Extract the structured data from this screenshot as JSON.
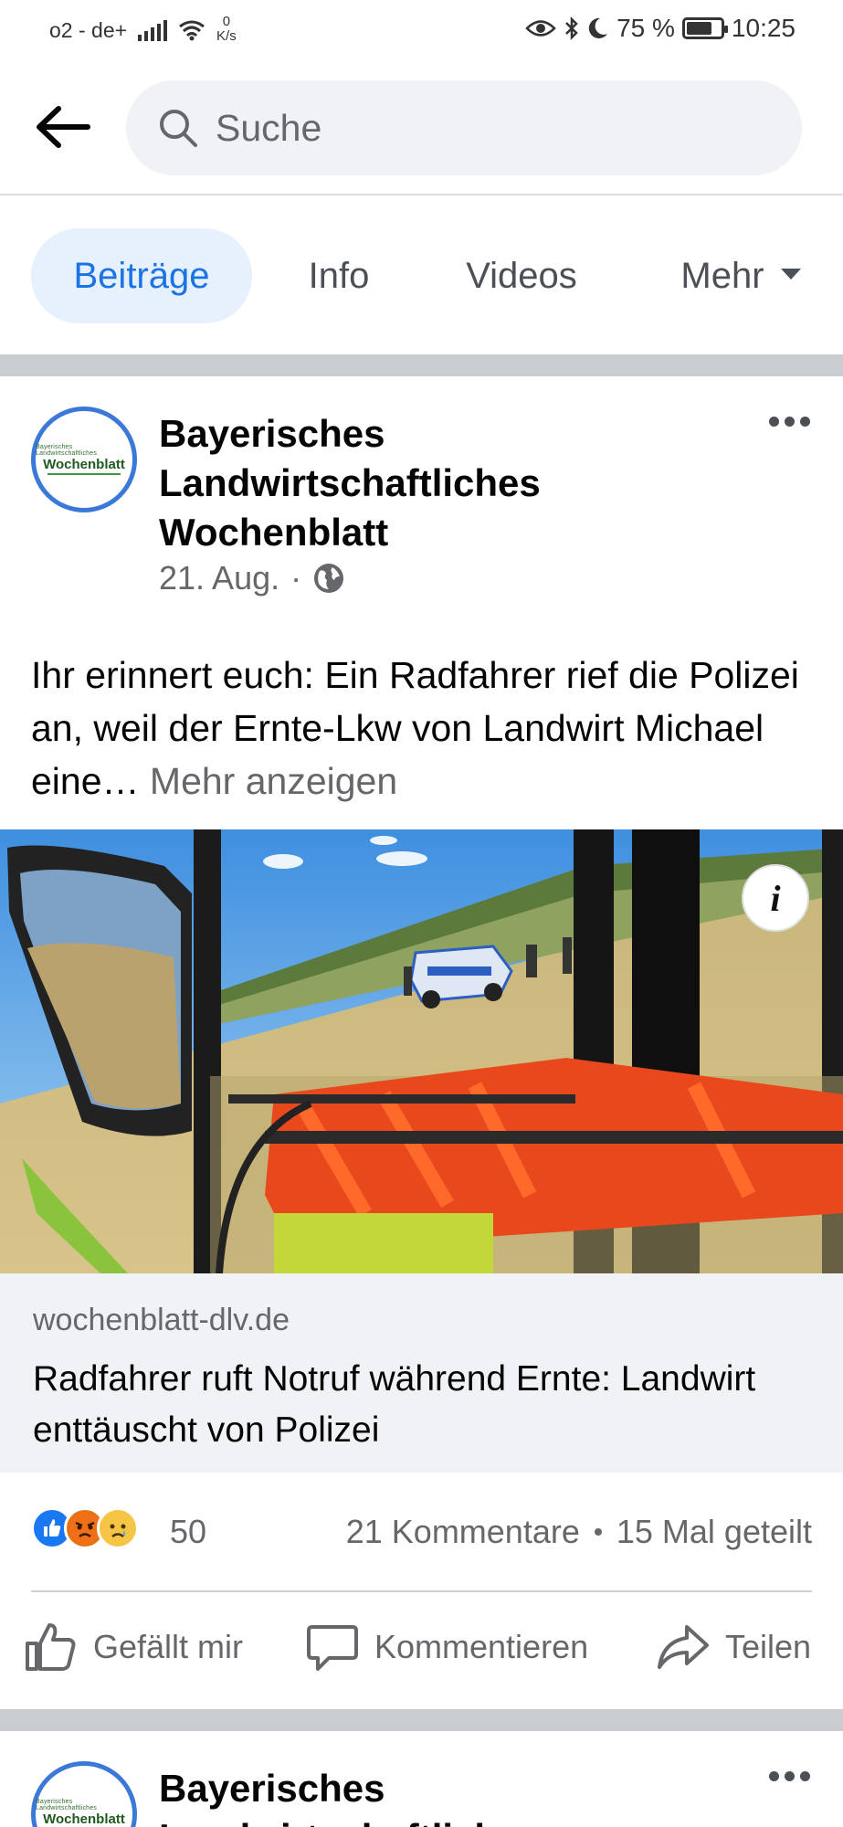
{
  "status_bar": {
    "carrier": "o2 - de+",
    "speed_value": "0",
    "speed_unit": "K/s",
    "battery": "75 %",
    "battery_level": 0.75,
    "time": "10:25"
  },
  "search": {
    "placeholder": "Suche"
  },
  "tabs": [
    {
      "label": "Beiträge",
      "active": true
    },
    {
      "label": "Info",
      "active": false
    },
    {
      "label": "Videos",
      "active": false
    },
    {
      "label": "Mehr",
      "active": false
    }
  ],
  "post": {
    "avatar_small_text": "Bayerisches Landwirtschaftliches",
    "avatar_brand": "Wochenblatt",
    "page_name": "Bayerisches Landwirtschaftliches Wochenblatt",
    "date": "21. Aug.",
    "separator": "·",
    "text": "Ihr erinnert euch: Ein Radfahrer rief die Polizei an, weil der Ernte-Lkw von Landwirt Michael eine…",
    "see_more": "Mehr anzeigen",
    "image_info": "i",
    "link_domain": "wochenblatt-dlv.de",
    "link_title": "Radfahrer ruft Notruf während Ernte: Landwirt enttäuscht von Polizei",
    "reaction_count": "50",
    "comments": "21 Kommentare",
    "shares": "15 Mal geteilt",
    "actions": {
      "like": "Gefällt mir",
      "comment": "Kommentieren",
      "share": "Teilen"
    }
  },
  "post2": {
    "avatar_small_text": "Bayerisches Landwirtschaftliches",
    "avatar_brand": "Wochenblatt",
    "page_name": "Bayerisches Landwirtschaftliches"
  },
  "colors": {
    "accent": "#1b74e4",
    "tab_active_bg": "#e7f0fd",
    "muted_text": "#65676b",
    "divider": "#c9ccd1"
  },
  "icons": [
    "back-arrow-icon",
    "search-icon",
    "globe-icon",
    "more-dots-icon",
    "info-icon",
    "like-reaction-icon",
    "angry-reaction-icon",
    "sad-reaction-icon",
    "thumbs-up-icon",
    "comment-icon",
    "share-icon",
    "chevron-down-icon"
  ]
}
